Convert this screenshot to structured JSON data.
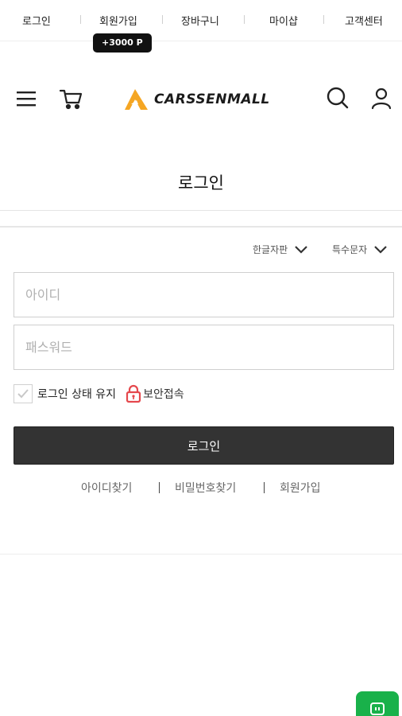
{
  "topbar": {
    "links": [
      "로그인",
      "회원가입",
      "장바구니",
      "마이샵",
      "고객센터"
    ],
    "points_badge": "+3000 P"
  },
  "header": {
    "brand": "CARSSENMALL",
    "icons": [
      "menu-icon",
      "cart-icon",
      "search-icon",
      "user-icon"
    ]
  },
  "page": {
    "title": "로그인"
  },
  "keyboard": {
    "korean_toggle": "한글자판",
    "special_toggle": "특수문자"
  },
  "form": {
    "id_placeholder": "아이디",
    "password_placeholder": "패스워드",
    "keep_login_label": "로그인 상태 유지",
    "secure_label": "보안접속",
    "login_button": "로그인"
  },
  "links": {
    "find_id": "아이디찾기",
    "find_password": "비밀번호찾기",
    "join": "회원가입"
  },
  "colors": {
    "button": "#333333",
    "chat_fab": "#19b14a",
    "lock": "#e5484d",
    "logo_accent": "#f5a623"
  }
}
